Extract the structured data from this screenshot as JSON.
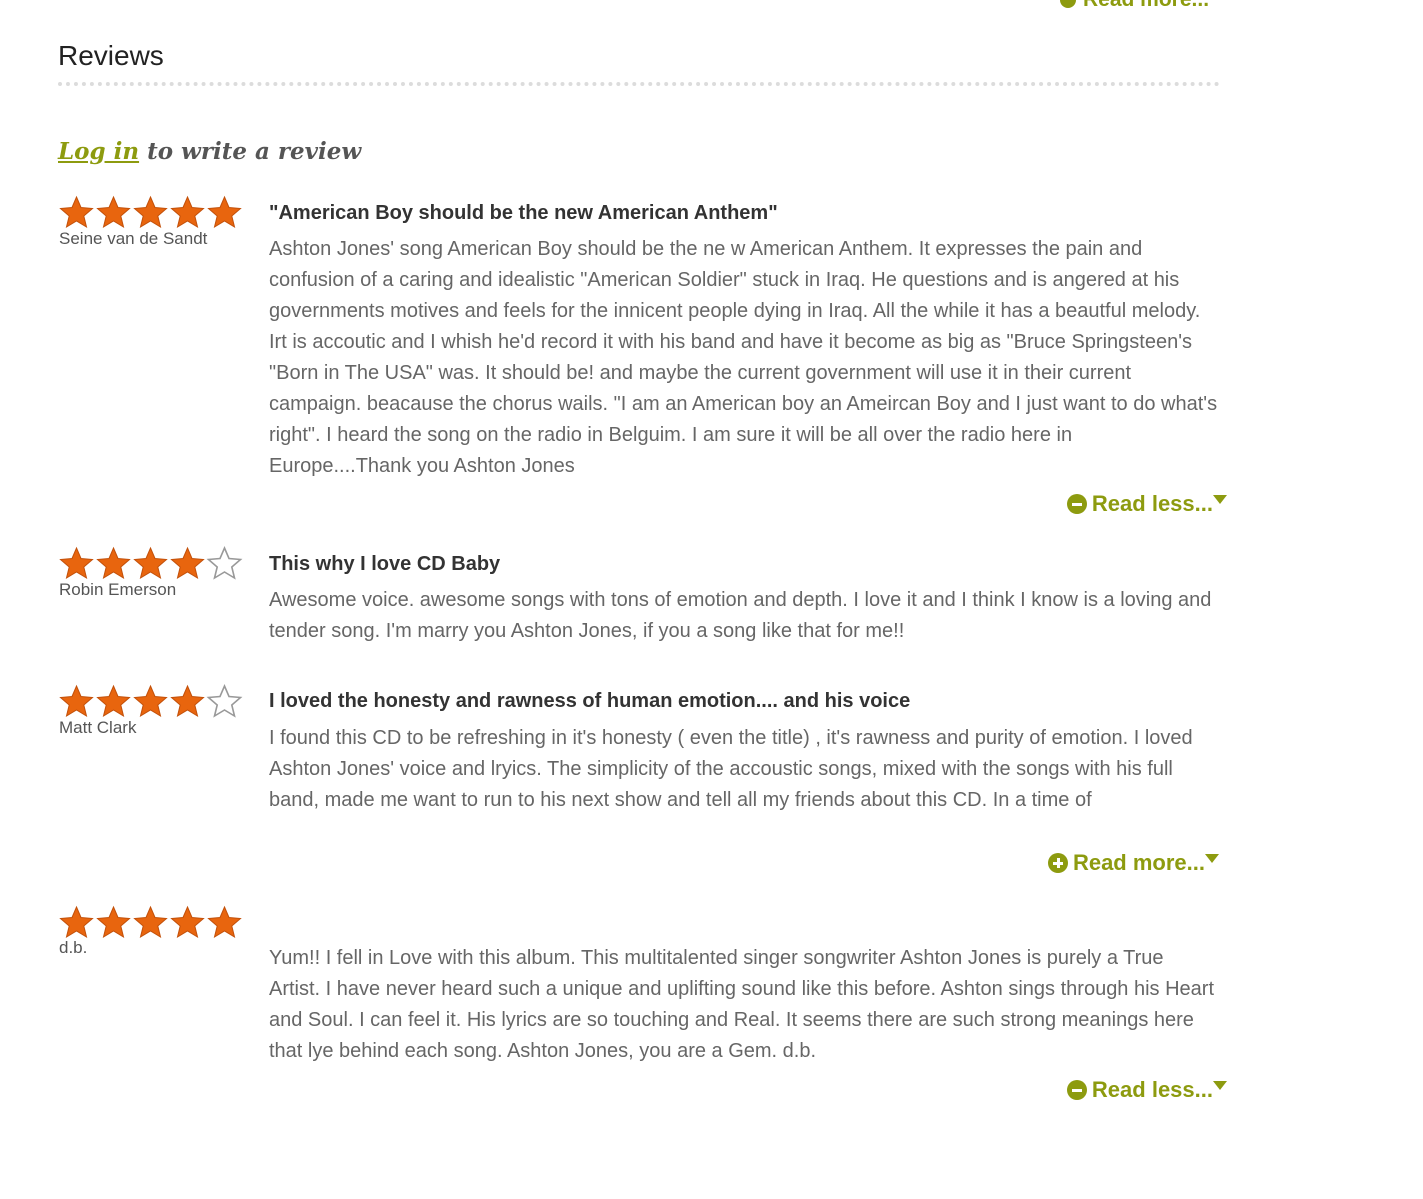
{
  "top": {
    "read_more_label": "Read more..."
  },
  "section": {
    "title": "Reviews"
  },
  "login": {
    "link_label": "Log in",
    "suffix": "to write a review"
  },
  "colors": {
    "accent": "#8d9b0f",
    "star_fill": "#e8650e",
    "star_empty": "#999999"
  },
  "reviews": [
    {
      "rating": 5,
      "author": "Seine van de Sandt",
      "title": "\"American Boy should be the new American Anthem\"",
      "body": "Ashton Jones' song American Boy should be the ne w American Anthem. It expresses the pain and confusion of a caring and idealistic \"American Soldier\" stuck in Iraq. He questions and is angered at his governments motives and feels for the innicent people dying in Iraq. All the while it has a beautful melody. Irt is accoutic and I whish he'd record it with his band and have it become as big as \"Bruce Springsteen's \"Born in The USA\" was. It should be! and maybe the current government will use it in their current campaign. beacause the chorus wails. \"I am an American boy an Ameircan Boy and I just want to do what's right\". I heard the song on the radio in Belguim. I am sure it will be all over the radio here in Europe....Thank you Ashton Jones",
      "toggle_label": "Read less...",
      "toggle_icon": "minus-circle-icon"
    },
    {
      "rating": 4,
      "author": "Robin Emerson",
      "title": "This why I love CD Baby",
      "body": "Awesome voice. awesome songs with tons of emotion and depth. I love it and I think I know is a loving and tender song. I'm marry you Ashton Jones, if you a song like that for me!!"
    },
    {
      "rating": 4,
      "author": "Matt Clark",
      "title": "I loved the honesty and rawness of human emotion.... and his voice",
      "body": "I found this CD to be refreshing in it's honesty ( even the title) , it's rawness and purity of emotion. I loved Ashton Jones' voice and lryics. The simplicity of the accoustic songs, mixed with the songs with his full band, made me want to run to his next show and tell all my friends about this CD. In a time of",
      "toggle_label": "Read more...",
      "toggle_icon": "plus-circle-icon"
    },
    {
      "rating": 5,
      "author": "d.b.",
      "title": "",
      "body": "Yum!! I fell in Love with this album. This multitalented singer songwriter Ashton Jones is purely a True Artist. I have never heard such a unique and uplifting sound like this before. Ashton sings through his Heart and Soul. I can feel it. His lyrics are so touching and Real. It seems there are such strong meanings here that lye behind each song. Ashton Jones, you are a Gem. d.b.",
      "toggle_label": "Read less...",
      "toggle_icon": "minus-circle-icon"
    }
  ]
}
